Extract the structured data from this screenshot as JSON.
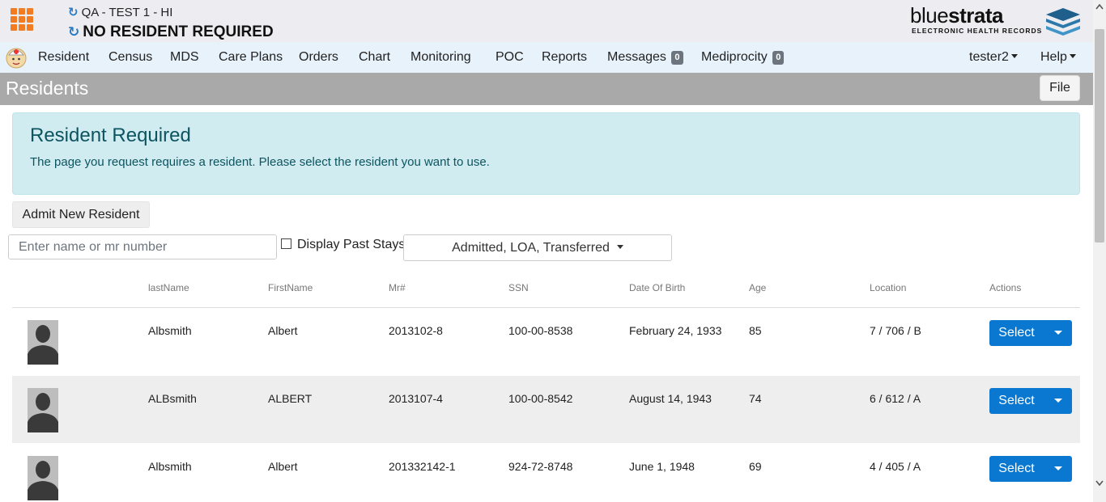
{
  "header": {
    "facility": "QA - TEST 1 - HI",
    "resident_status": "NO RESIDENT REQUIRED",
    "logo": {
      "thin": "blue",
      "bold": "strata",
      "sub": "ELECTRONIC HEALTH RECORDS"
    }
  },
  "nav": {
    "items": [
      {
        "label": "Resident"
      },
      {
        "label": "Census"
      },
      {
        "label": "MDS"
      },
      {
        "label": "Care Plans"
      },
      {
        "label": "Orders"
      },
      {
        "label": "Chart"
      },
      {
        "label": "Monitoring"
      },
      {
        "label": "POC"
      },
      {
        "label": "Reports"
      },
      {
        "label": "Messages",
        "badge": "0"
      },
      {
        "label": "Mediprocity",
        "badge": "0"
      }
    ],
    "user": "tester2",
    "help": "Help"
  },
  "page": {
    "title": "Residents",
    "file_label": "File"
  },
  "alert": {
    "title": "Resident Required",
    "text": "The page you request requires a resident. Please select the resident you want to use."
  },
  "controls": {
    "admit_label": "Admit New Resident",
    "search_placeholder": "Enter name or mr number",
    "past_stays_label": "Display Past Stays",
    "status_filter": "Admitted, LOA, Transferred"
  },
  "table": {
    "headers": [
      "lastName",
      "FirstName",
      "Mr#",
      "SSN",
      "Date Of Birth",
      "Age",
      "Location",
      "Actions"
    ],
    "rows": [
      {
        "last": "Albsmith",
        "first": "Albert",
        "mr": "2013102-8",
        "ssn": "100-00-8538",
        "dob": "February 24, 1933",
        "age": "85",
        "location": "7 / 706 / B",
        "action": "Select"
      },
      {
        "last": "ALBsmith",
        "first": "ALBERT",
        "mr": "2013107-4",
        "ssn": "100-00-8542",
        "dob": "August 14, 1943",
        "age": "74",
        "location": "6 / 612 / A",
        "action": "Select"
      },
      {
        "last": "Albsmith",
        "first": "Albert",
        "mr": "201332142-1",
        "ssn": "924-72-8748",
        "dob": "June 1, 1948",
        "age": "69",
        "location": "4 / 405 / A",
        "action": "Select"
      }
    ]
  },
  "colors": {
    "accent": "#0a78d0",
    "orange": "#f07c24",
    "alert_bg": "#d1ecf1",
    "alert_text": "#0c5460",
    "nav_bg": "#e8f2fb",
    "page_header_bg": "#a9a9a9"
  },
  "icons": {
    "apps": "apps-grid-icon",
    "refresh": "refresh-icon",
    "avatar": "person-silhouette-icon",
    "nav_logo": "nurse-icon"
  }
}
